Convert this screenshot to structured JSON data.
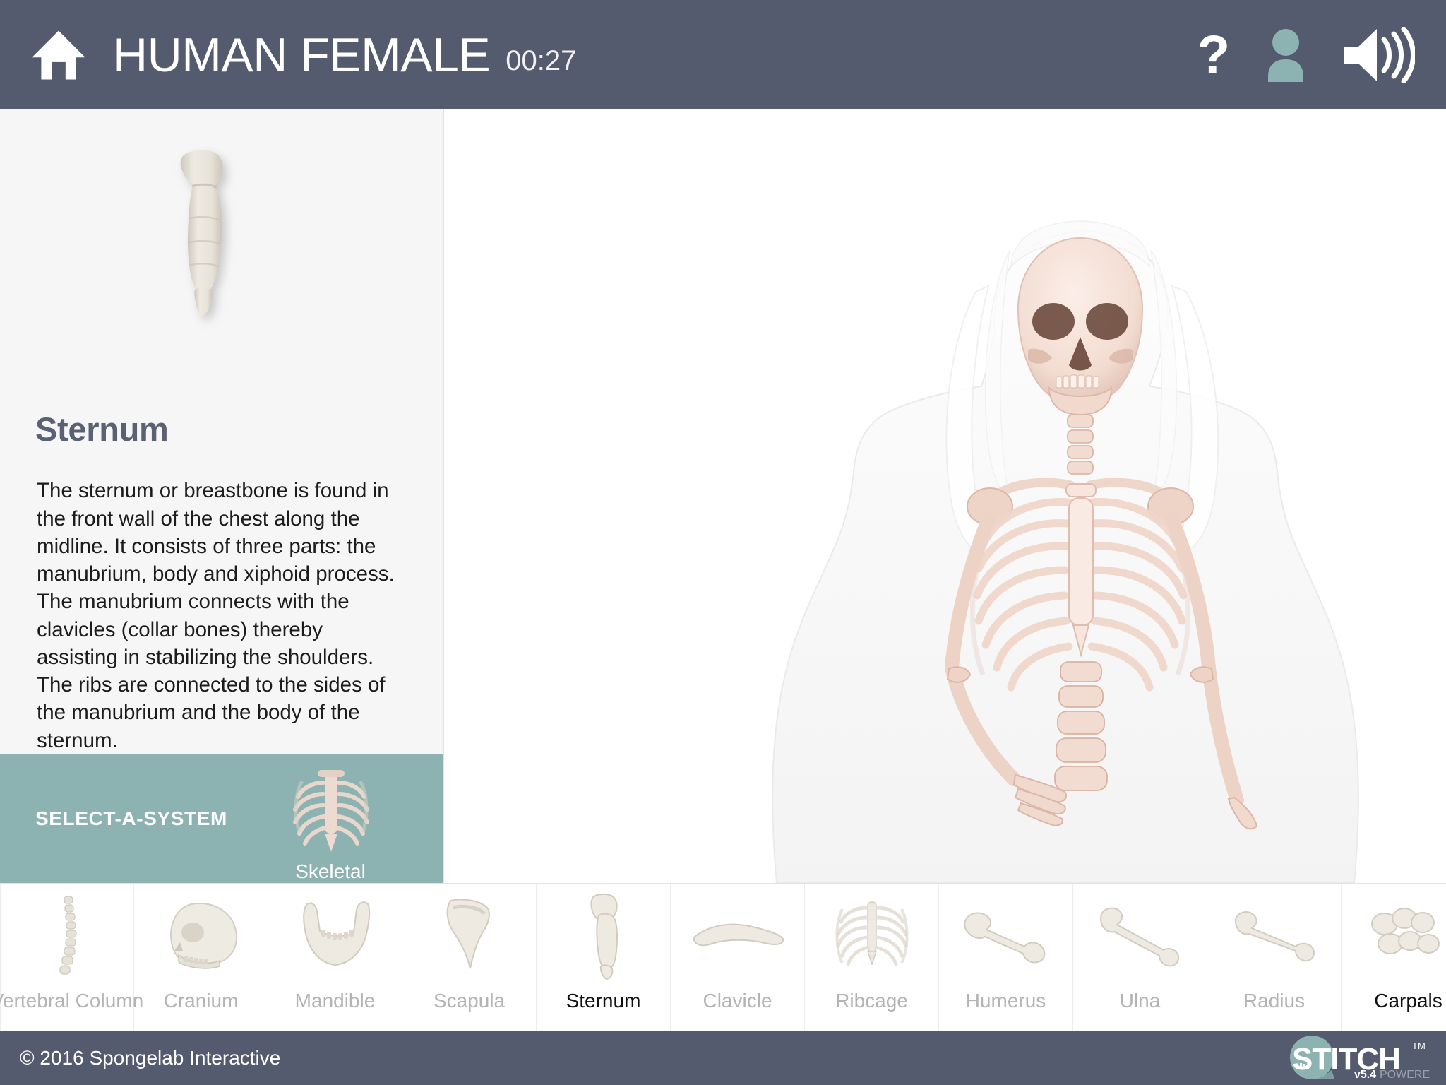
{
  "header": {
    "home_icon": "home-icon",
    "title": "HUMAN FEMALE",
    "timer": "00:27",
    "help_icon": "question-mark-icon",
    "help_label": "?",
    "user_icon": "user-profile-icon",
    "sound_icon": "speaker-volume-icon",
    "background_color": "#555b6e",
    "accent_color": "#8cb3b1"
  },
  "info_panel": {
    "bone_image": "sternum-bone-render",
    "title": "Sternum",
    "description": "The sternum or breastbone is found in the front wall of the chest along the midline. It consists of three parts: the manubrium, body and xiphoid process. The manubrium connects with the clavicles (collar bones) thereby assisting in stabilizing the shoulders. The ribs are connected to the sides of the manubrium and the body of the sternum."
  },
  "select_a_system": {
    "label": "SELECT-A-SYSTEM",
    "current_system": "Skeletal",
    "thumbnail": "skeletal-system-thumbnail",
    "background_color": "#8cb3b1"
  },
  "stage": {
    "model": "human-female-skeletal-anterior-view",
    "highlighted_bone": "Sternum"
  },
  "carousel": {
    "items": [
      {
        "label": "Vertebral Column",
        "icon": "vertebral-column-thumbnail",
        "selected": false
      },
      {
        "label": "Cranium",
        "icon": "cranium-thumbnail",
        "selected": false
      },
      {
        "label": "Mandible",
        "icon": "mandible-thumbnail",
        "selected": false
      },
      {
        "label": "Scapula",
        "icon": "scapula-thumbnail",
        "selected": false
      },
      {
        "label": "Sternum",
        "icon": "sternum-thumbnail",
        "selected": true
      },
      {
        "label": "Clavicle",
        "icon": "clavicle-thumbnail",
        "selected": false
      },
      {
        "label": "Ribcage",
        "icon": "ribcage-thumbnail",
        "selected": false
      },
      {
        "label": "Humerus",
        "icon": "humerus-thumbnail",
        "selected": false
      },
      {
        "label": "Ulna",
        "icon": "ulna-thumbnail",
        "selected": false
      },
      {
        "label": "Radius",
        "icon": "radius-thumbnail",
        "selected": false
      },
      {
        "label": "Carpals",
        "icon": "carpals-thumbnail",
        "selected": false
      }
    ]
  },
  "footer": {
    "copyright": "© 2016 Spongelab Interactive",
    "logo_text": "STITCH",
    "logo_trademark": "TM",
    "logo_version": "v5.4",
    "logo_tagline": "POWERED"
  }
}
